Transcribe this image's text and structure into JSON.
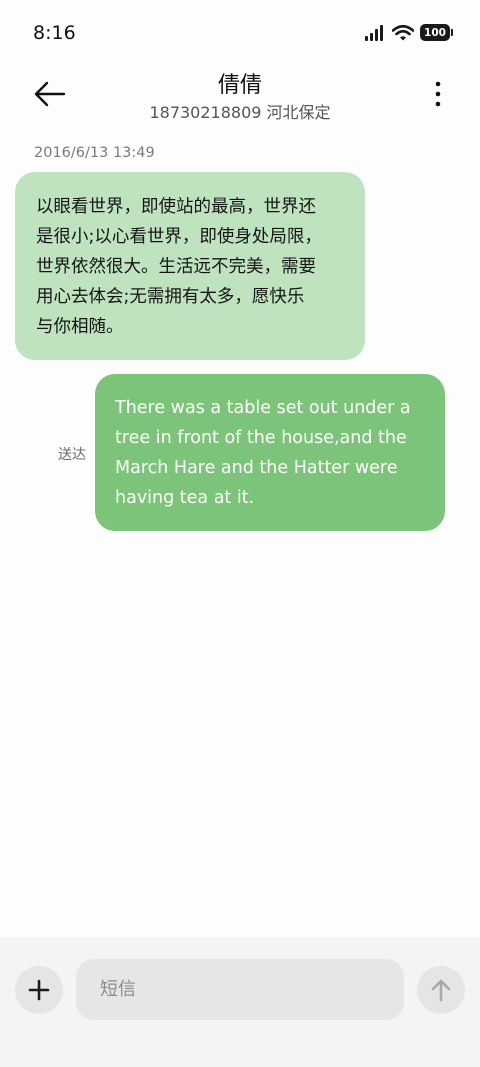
{
  "status_bar": {
    "time": "8:16",
    "battery_level": "100",
    "icons": [
      "signal-icon",
      "wifi-icon",
      "battery-icon"
    ]
  },
  "header": {
    "contact_name": "倩倩",
    "contact_number": "18730218809 河北保定",
    "icons": [
      "back-arrow-icon",
      "more-vertical-icon"
    ]
  },
  "conversation": {
    "timestamp": "2016/6/13 13:49",
    "messages": [
      {
        "direction": "incoming",
        "lines": [
          "以眼看世界，即使站的最高，世界还",
          "是很小;以心看世界，即使身处局限，",
          "世界依然很大。生活远不完美，需要",
          "用心去体会;无需拥有太多，愿快乐",
          "与你相随。"
        ]
      },
      {
        "direction": "outgoing",
        "status": "送达",
        "lines": [
          "There was a table set out under a",
          "tree in front of the house,and the",
          "March Hare and the Hatter were",
          "having tea at it."
        ]
      }
    ]
  },
  "composer": {
    "placeholder": "短信",
    "value": "",
    "icons": [
      "plus-icon",
      "send-arrow-icon"
    ]
  },
  "colors": {
    "incoming_bubble": "#bfe2bf",
    "outgoing_bubble": "#7cc47a",
    "composer_background": "#f4f4f4"
  }
}
